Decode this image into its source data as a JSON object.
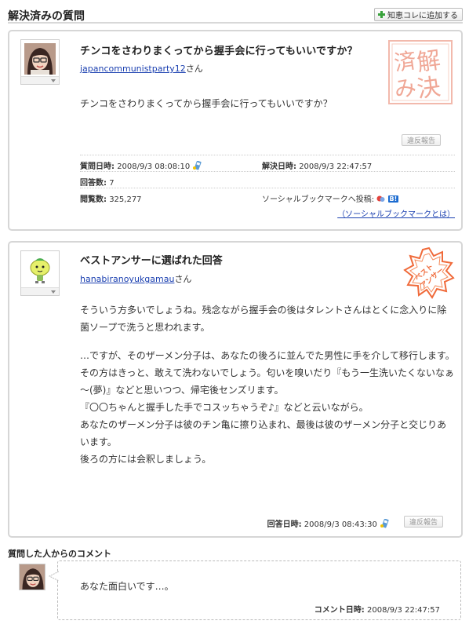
{
  "header": {
    "title": "解決済みの質問",
    "add_button_label": "知恵コレに追加する"
  },
  "question": {
    "title": "チンコをさわりまくってから握手会に行ってもいいですか？",
    "user": "japancommunistparty12",
    "honorific": "さん",
    "body": "チンコをさわりまくってから握手会に行ってもいいですか？",
    "report_label": "違反報告",
    "stamp_text": "解決済み",
    "meta": {
      "asked_label": "質問日時:",
      "asked_value": "2008/9/3 08:08:10",
      "resolved_label": "解決日時:",
      "resolved_value": "2008/9/3 22:47:57",
      "answers_label": "回答数:",
      "answers_value": "7",
      "views_label": "閲覧数:",
      "views_value": "325,277",
      "sbm_label": "ソーシャルブックマークへ投稿:",
      "sbm_help_link": "（ソーシャルブックマークとは）",
      "hatena_badge": "B!"
    }
  },
  "best_answer": {
    "title": "ベストアンサーに選ばれた回答",
    "user": "hanabiranoyukgamau",
    "honorific": "さん",
    "stamp_text": "ベスト アンサー",
    "paragraphs": [
      [
        "そういう方多いでしょうね。残念ながら握手会の後はタレントさんはとくに念入りに除菌ソープで洗うと思われます。"
      ],
      [
        "…ですが、そのザーメン分子は、あなたの後ろに並んでた男性に手を介して移行します。",
        "その方はきっと、敢えて洗わないでしょう。匂いを嗅いだり『もう一生洗いたくないなぁ～(夢)』などと思いつつ、帰宅後センズリます。",
        "『〇〇ちゃんと握手した手でコスッちゃうぞ♪』などと云いながら。",
        "あなたのザーメン分子は彼のチン亀に擦り込まれ、最後は彼のザーメン分子と交じりあいます。",
        "後ろの方には会釈しましょう。"
      ]
    ],
    "date_label": "回答日時:",
    "date_value": "2008/9/3 08:43:30",
    "report_label": "違反報告"
  },
  "comment": {
    "section_title": "質問した人からのコメント",
    "text": "あなた面白いです…。",
    "date_label": "コメント日時:",
    "date_value": "2008/9/3 22:47:57"
  }
}
